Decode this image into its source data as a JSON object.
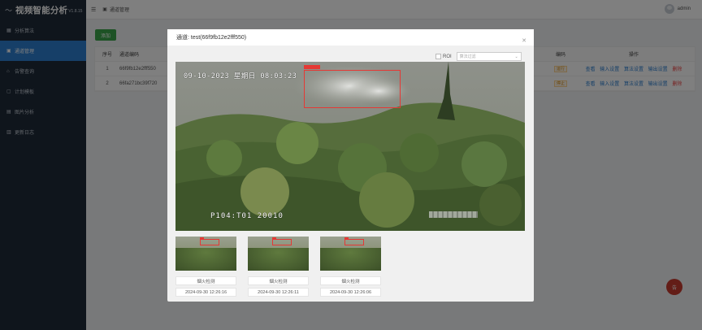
{
  "app": {
    "name": "视频智能分析",
    "version": "V1.8.15"
  },
  "sidebar": {
    "items": [
      {
        "label": "分析算法",
        "icon": "grid-icon",
        "active": false
      },
      {
        "label": "通道管理",
        "icon": "camera-icon",
        "active": true
      },
      {
        "label": "告警查询",
        "icon": "bell-icon",
        "active": false
      },
      {
        "label": "计划模板",
        "icon": "calendar-icon",
        "active": false
      },
      {
        "label": "图片分析",
        "icon": "image-icon",
        "active": false
      },
      {
        "label": "更新日志",
        "icon": "log-icon",
        "active": false
      }
    ]
  },
  "header": {
    "breadcrumb": "通道管理",
    "user": "admin"
  },
  "toolbar": {
    "add_label": "添加"
  },
  "table": {
    "headers": {
      "idx": "序号",
      "id": "通道编码",
      "status": "编码",
      "ops": "操作"
    },
    "rows": [
      {
        "idx": "1",
        "id": "66f9fb12e2fff550",
        "tag": "运行"
      },
      {
        "idx": "2",
        "id": "66fa271bc39f720",
        "tag": "停止"
      }
    ],
    "ops": [
      "查看",
      "输入设置",
      "算法设置",
      "输出设置",
      "删除"
    ]
  },
  "fab": {
    "label": "告"
  },
  "modal": {
    "title": "通道: test(66f9fb12e2fff550)",
    "roi_label": "ROI",
    "select_placeholder": "算法过滤",
    "video": {
      "timestamp": "09-10-2023 星期日 08:03:23",
      "camera_label": "P104:T01    20010"
    },
    "thumbs": [
      {
        "label": "烟火检测",
        "time": "2024-09-30 12:26:16"
      },
      {
        "label": "烟火检测",
        "time": "2024-09-30 12:26:11"
      },
      {
        "label": "烟火检测",
        "time": "2024-09-30 12:26:06"
      }
    ]
  },
  "colors": {
    "sidebar_bg": "#1f2a38",
    "accent": "#2d7fd0",
    "add_button": "#3aa54b",
    "detection_box": "#e53935",
    "fab": "#c73a2e"
  }
}
